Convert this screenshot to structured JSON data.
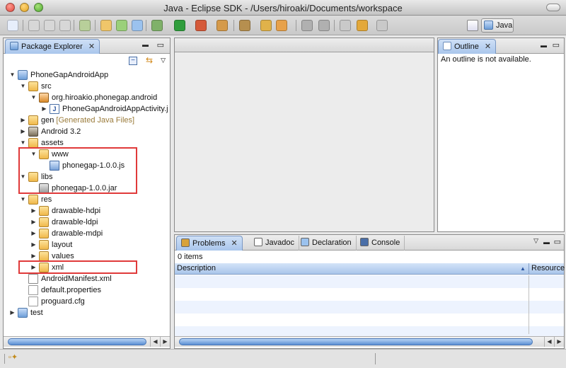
{
  "window": {
    "title": "Java - Eclipse SDK - /Users/hiroaki/Documents/workspace"
  },
  "toolbar": {
    "perspective_label": "Java",
    "icons": [
      "new-icon",
      "save-icon",
      "save-all-icon",
      "print-icon",
      "import-icon",
      "new-java-project-icon",
      "new-package-icon",
      "new-class-icon",
      "debug-icon",
      "run-icon",
      "external-tools-icon",
      "new-server-icon",
      "search-icon",
      "open-type-icon",
      "open-task-icon",
      "next-annotation-icon",
      "previous-annotation-icon",
      "last-edit-icon",
      "back-icon",
      "forward-icon"
    ]
  },
  "package_explorer": {
    "tab_label": "Package Explorer",
    "tree": [
      {
        "label": "PhoneGapAndroidApp",
        "icon": "project-icon",
        "expanded": true,
        "depth": 0
      },
      {
        "label": "src",
        "icon": "source-folder-icon",
        "expanded": true,
        "depth": 1
      },
      {
        "label": "org.hiroakio.phonegap.android",
        "icon": "package-icon",
        "expanded": true,
        "depth": 2
      },
      {
        "label": "PhoneGapAndroidAppActivity.j",
        "icon": "java-file-icon",
        "expanded": false,
        "depth": 3
      },
      {
        "label": "gen",
        "decoration": "[Generated Java Files]",
        "icon": "source-folder-icon",
        "expanded": false,
        "depth": 1
      },
      {
        "label": "Android 3.2",
        "icon": "library-icon",
        "expanded": false,
        "depth": 1
      },
      {
        "label": "assets",
        "icon": "folder-icon",
        "expanded": true,
        "depth": 1
      },
      {
        "label": "www",
        "icon": "folder-icon",
        "expanded": true,
        "depth": 2
      },
      {
        "label": "phonegap-1.0.0.js",
        "icon": "js-file-icon",
        "depth": 3
      },
      {
        "label": "libs",
        "icon": "folder-icon",
        "expanded": true,
        "depth": 1
      },
      {
        "label": "phonegap-1.0.0.jar",
        "icon": "jar-icon",
        "depth": 2
      },
      {
        "label": "res",
        "icon": "folder-icon",
        "expanded": true,
        "depth": 1
      },
      {
        "label": "drawable-hdpi",
        "icon": "folder-icon",
        "expanded": false,
        "depth": 2
      },
      {
        "label": "drawable-ldpi",
        "icon": "folder-icon",
        "expanded": false,
        "depth": 2
      },
      {
        "label": "drawable-mdpi",
        "icon": "folder-icon",
        "expanded": false,
        "depth": 2
      },
      {
        "label": "layout",
        "icon": "folder-icon",
        "expanded": false,
        "depth": 2
      },
      {
        "label": "values",
        "icon": "folder-icon",
        "expanded": false,
        "depth": 2
      },
      {
        "label": "xml",
        "icon": "folder-icon",
        "expanded": false,
        "depth": 2
      },
      {
        "label": "AndroidManifest.xml",
        "icon": "xml-file-icon",
        "depth": 1
      },
      {
        "label": "default.properties",
        "icon": "properties-file-icon",
        "depth": 1
      },
      {
        "label": "proguard.cfg",
        "icon": "properties-file-icon",
        "depth": 1
      },
      {
        "label": "test",
        "icon": "project-icon",
        "expanded": false,
        "depth": 0
      }
    ]
  },
  "outline": {
    "tab_label": "Outline",
    "message": "An outline is not available."
  },
  "bottom_panel": {
    "tabs": [
      {
        "label": "Problems",
        "icon": "problems-icon",
        "active": true
      },
      {
        "label": "Javadoc",
        "icon": "javadoc-icon",
        "active": false
      },
      {
        "label": "Declaration",
        "icon": "declaration-icon",
        "active": false
      },
      {
        "label": "Console",
        "icon": "console-icon",
        "active": false
      }
    ],
    "item_count": "0 items",
    "columns": [
      "Description",
      "Resource"
    ]
  },
  "colors": {
    "highlight_box": "#e03a3a",
    "active_tab": "#a9c6ec"
  }
}
